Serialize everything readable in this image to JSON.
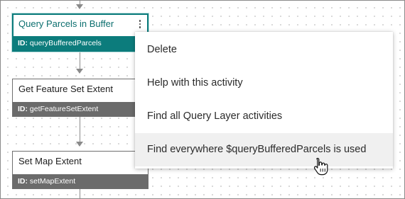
{
  "activities": [
    {
      "title": "Query Parcels in Buffer",
      "id_label": "ID:",
      "id_value": "queryBufferedParcels",
      "selected": true
    },
    {
      "title": "Get Feature Set Extent",
      "id_label": "ID:",
      "id_value": "getFeatureSetExtent",
      "selected": false
    },
    {
      "title": "Set Map Extent",
      "id_label": "ID:",
      "id_value": "setMapExtent",
      "selected": false
    }
  ],
  "context_menu": {
    "items": [
      {
        "label": "Delete"
      },
      {
        "label": "Help with this activity"
      },
      {
        "label": "Find all Query Layer activities"
      },
      {
        "label": "Find everywhere $queryBufferedParcels is used",
        "hovered": true
      }
    ]
  },
  "icons": {
    "card_menu": "vertical-ellipsis-icon",
    "cursor": "hand-pointer-icon"
  },
  "colors": {
    "selected_accent": "#0c7c7c",
    "id_bar_default": "#6b6b6b",
    "menu_hover": "#f0f0f0"
  }
}
